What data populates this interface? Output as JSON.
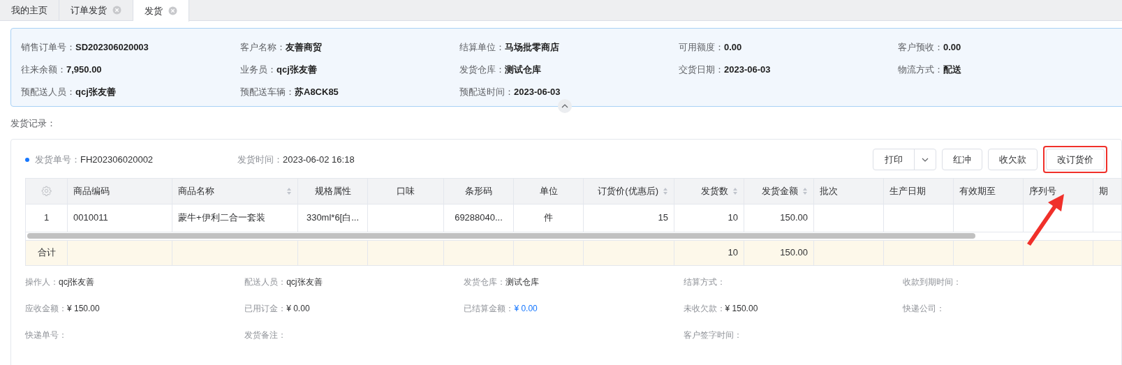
{
  "tabs": [
    {
      "label": "我的主页",
      "selected": false,
      "closable": false
    },
    {
      "label": "订单发货",
      "selected": false,
      "closable": true
    },
    {
      "label": "发货",
      "selected": true,
      "closable": true
    }
  ],
  "order_info": [
    {
      "label": "销售订单号：",
      "value": "SD202306020003"
    },
    {
      "label": "客户名称：",
      "value": "友善商贸"
    },
    {
      "label": "结算单位：",
      "value": "马场批零商店"
    },
    {
      "label": "可用额度：",
      "value": "0.00"
    },
    {
      "label": "客户预收：",
      "value": "0.00"
    },
    {
      "label": "往来余额：",
      "value": "7,950.00"
    },
    {
      "label": "业务员：",
      "value": "qcj张友善"
    },
    {
      "label": "发货仓库：",
      "value": "测试仓库"
    },
    {
      "label": "交货日期：",
      "value": "2023-06-03"
    },
    {
      "label": "物流方式：",
      "value": "配送"
    },
    {
      "label": "预配送人员：",
      "value": "qcj张友善"
    },
    {
      "label": "预配送车辆：",
      "value": "苏A8CK85"
    },
    {
      "label": "预配送时间：",
      "value": "2023-06-03"
    }
  ],
  "section_title": "发货记录：",
  "shipment": {
    "number_label": "发货单号：",
    "number": "FH202306020002",
    "time_label": "发货时间：",
    "time": "2023-06-02 16:18",
    "print_button": "打印",
    "buttons": [
      {
        "label": "红冲",
        "highlighted": false
      },
      {
        "label": "收欠款",
        "highlighted": false
      },
      {
        "label": "改订货价",
        "highlighted": true
      }
    ]
  },
  "table": {
    "columns": [
      {
        "label": "商品编码",
        "sortable": false
      },
      {
        "label": "商品名称",
        "sortable": true
      },
      {
        "label": "规格属性",
        "sortable": false
      },
      {
        "label": "口味",
        "sortable": false
      },
      {
        "label": "条形码",
        "sortable": false
      },
      {
        "label": "单位",
        "sortable": false
      },
      {
        "label": "订货价(优惠后)",
        "sortable": true
      },
      {
        "label": "发货数",
        "sortable": true
      },
      {
        "label": "发货金额",
        "sortable": true
      },
      {
        "label": "批次",
        "sortable": false
      },
      {
        "label": "生产日期",
        "sortable": false
      },
      {
        "label": "有效期至",
        "sortable": false
      },
      {
        "label": "序列号",
        "sortable": false
      },
      {
        "label": "期"
      }
    ],
    "rows": [
      {
        "index": "1",
        "cells": [
          "0010011",
          "蒙牛+伊利二合一套装",
          "330ml*6[白...",
          "",
          "69288040...",
          "件",
          "15",
          "10",
          "150.00",
          "",
          "",
          "",
          "",
          ""
        ]
      }
    ],
    "totals": {
      "label": "合计",
      "cells": [
        "",
        "",
        "",
        "",
        "",
        "",
        "",
        "10",
        "150.00",
        "",
        "",
        "",
        "",
        ""
      ]
    }
  },
  "detail_columns": [
    [
      {
        "label": "操作人：",
        "value": "qcj张友善",
        "highlight": false
      },
      {
        "label": "应收金额：",
        "value": "¥ 150.00",
        "highlight": false
      },
      {
        "label": "快递单号："
      }
    ],
    [
      {
        "label": "配送人员：",
        "value": "qcj张友善",
        "highlight": false
      },
      {
        "label": "已用订金：",
        "value": "¥ 0.00",
        "highlight": false
      },
      {
        "label": "发货备注："
      }
    ],
    [
      {
        "label": "发货仓库：",
        "value": "测试仓库",
        "highlight": false
      },
      {
        "label": "已结算金额：",
        "value": "¥ 0.00",
        "highlight": true
      }
    ],
    [
      {
        "label": "结算方式："
      },
      {
        "label": "未收欠款：",
        "value": "¥ 150.00",
        "highlight": false
      },
      {
        "label": "客户签字时间："
      }
    ],
    [
      {
        "label": "收款到期时间："
      },
      {
        "label": "快递公司："
      }
    ]
  ]
}
